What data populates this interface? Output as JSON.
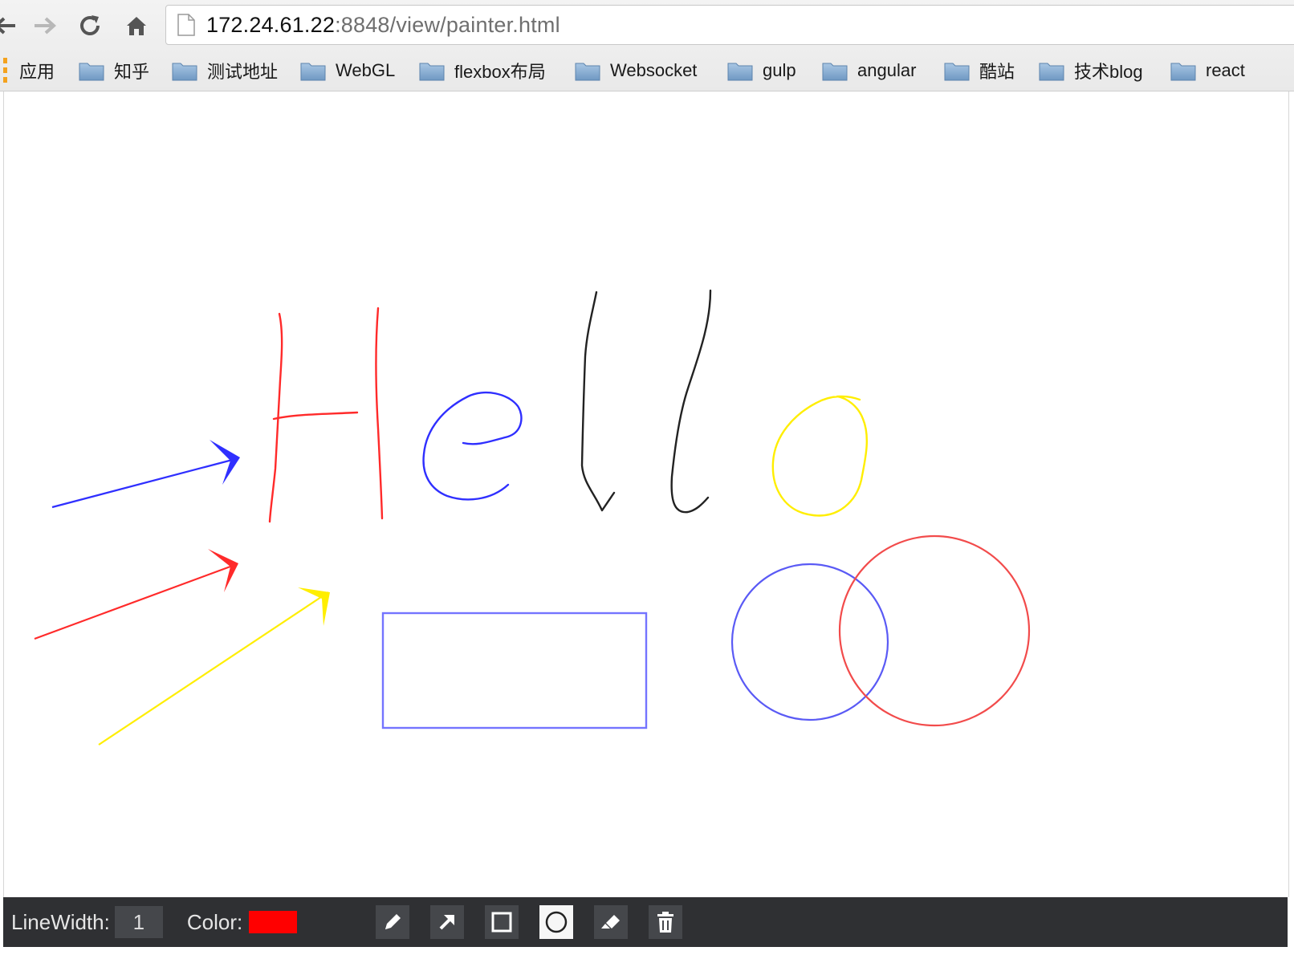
{
  "browser": {
    "url_host": "172.24.61.22",
    "url_path": ":8848/view/painter.html",
    "bookmarks": [
      {
        "label": "应用",
        "icon": "apps-icon"
      },
      {
        "label": "知乎",
        "icon": "folder-icon"
      },
      {
        "label": "测试地址",
        "icon": "folder-icon"
      },
      {
        "label": "WebGL",
        "icon": "folder-icon"
      },
      {
        "label": "flexbox布局",
        "icon": "folder-icon"
      },
      {
        "label": "Websocket",
        "icon": "folder-icon"
      },
      {
        "label": "gulp",
        "icon": "folder-icon"
      },
      {
        "label": "angular",
        "icon": "folder-icon"
      },
      {
        "label": "酷站",
        "icon": "folder-icon"
      },
      {
        "label": "技术blog",
        "icon": "folder-icon"
      },
      {
        "label": "react",
        "icon": "folder-icon"
      }
    ]
  },
  "toolbar": {
    "linewidth_label": "LineWidth:",
    "linewidth_value": "1",
    "color_label": "Color:",
    "current_color": "#ff0000",
    "tools": [
      {
        "name": "pencil-tool",
        "icon": "pencil-icon",
        "active": false
      },
      {
        "name": "arrow-tool",
        "icon": "arrow-icon",
        "active": false
      },
      {
        "name": "rectangle-tool",
        "icon": "square-icon",
        "active": false
      },
      {
        "name": "circle-tool",
        "icon": "circle-icon",
        "active": true
      },
      {
        "name": "eraser-tool",
        "icon": "eraser-icon",
        "active": false
      },
      {
        "name": "clear-tool",
        "icon": "trash-icon",
        "active": false
      }
    ]
  },
  "colors": {
    "blue": "#2f2fff",
    "red": "#ff2a2a",
    "yellow": "#ffee00",
    "black": "#222222",
    "rect_blue": "#7474ff",
    "circle_blue": "#5a5af5",
    "circle_red": "#f24b4b"
  }
}
